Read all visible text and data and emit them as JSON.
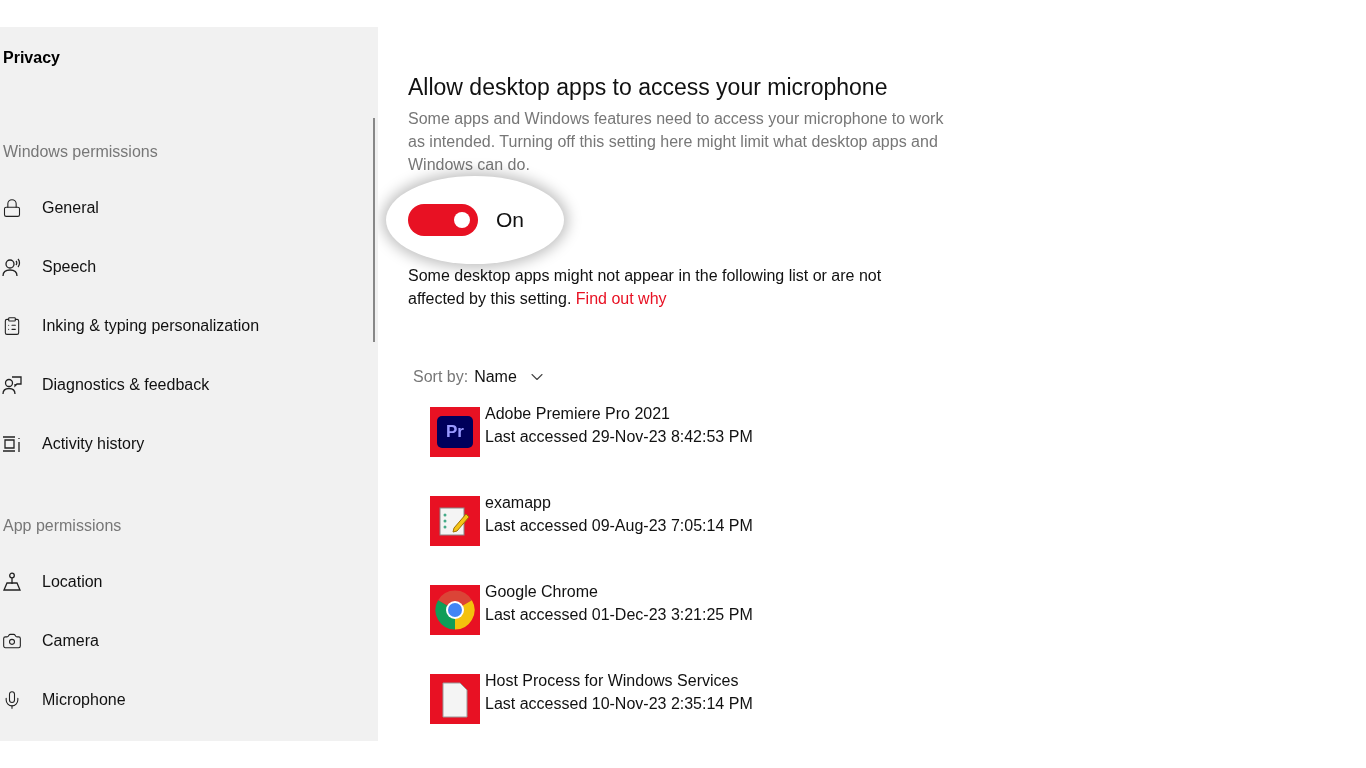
{
  "sidebar": {
    "title": "Privacy",
    "sections": [
      {
        "heading": "Windows permissions",
        "items": [
          {
            "label": "General",
            "kind": "lock"
          },
          {
            "label": "Speech",
            "kind": "speech"
          },
          {
            "label": "Inking & typing personalization",
            "kind": "clipboard"
          },
          {
            "label": "Diagnostics & feedback",
            "kind": "feedback"
          },
          {
            "label": "Activity history",
            "kind": "activity"
          }
        ]
      },
      {
        "heading": "App permissions",
        "items": [
          {
            "label": "Location",
            "kind": "location"
          },
          {
            "label": "Camera",
            "kind": "camera"
          },
          {
            "label": "Microphone",
            "kind": "microphone"
          }
        ]
      }
    ]
  },
  "main": {
    "heading": "Allow desktop apps to access your microphone",
    "description": "Some apps and Windows features need to access your microphone to work as intended. Turning off this setting here might limit what desktop apps and Windows can do.",
    "toggle": {
      "on": true,
      "label": "On"
    },
    "note": "Some desktop apps might not appear in the following list or are not affected by this setting.",
    "note_link": "Find out why",
    "sort": {
      "label": "Sort by:",
      "value": "Name"
    },
    "apps": [
      {
        "name": "Adobe Premiere Pro 2021",
        "accessed": "Last accessed 29-Nov-23 8:42:53 PM",
        "kind": "premiere",
        "icon_text": "Pr"
      },
      {
        "name": "examapp",
        "accessed": "Last accessed 09-Aug-23 7:05:14 PM",
        "kind": "notepad"
      },
      {
        "name": "Google Chrome",
        "accessed": "Last accessed 01-Dec-23 3:21:25 PM",
        "kind": "chrome"
      },
      {
        "name": "Host Process for Windows Services",
        "accessed": "Last accessed 10-Nov-23 2:35:14 PM",
        "kind": "file"
      }
    ]
  }
}
